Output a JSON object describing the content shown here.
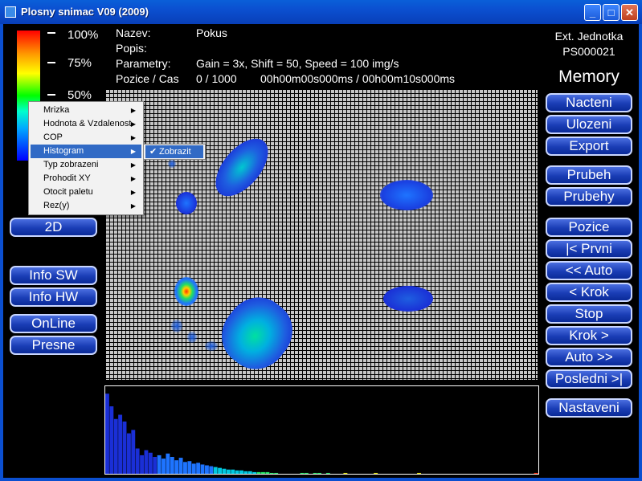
{
  "window": {
    "title": "Plosny snimac V09 (2009)",
    "minimize": "_",
    "maximize": "□",
    "close": "✕"
  },
  "palette_labels": [
    "100%",
    "75%",
    "50%"
  ],
  "info": {
    "nazev_label": "Nazev:",
    "nazev_value": "Pokus",
    "popis_label": "Popis:",
    "parametry_label": "Parametry:",
    "parametry_value": "Gain = 3x, Shift = 50, Speed = 100 img/s",
    "pozice_label": "Pozice / Cas",
    "pozice_value": "0 / 1000",
    "cas_value": "00h00m00s000ms / 00h00m10s000ms"
  },
  "device": {
    "line1": "Ext. Jednotka",
    "line2": "PS000021",
    "memory": "Memory"
  },
  "right_buttons": [
    "Nacteni",
    "Ulozeni",
    "Export",
    "Prubeh",
    "Prubehy",
    "Pozice",
    "|< Prvni",
    "<< Auto",
    "< Krok",
    "Stop",
    "Krok >",
    "Auto >>",
    "Posledni >|",
    "Nastaveni"
  ],
  "left_buttons": [
    "2D",
    "Info SW",
    "Info HW",
    "OnLine",
    "Presne"
  ],
  "context_menu": {
    "items": [
      "Mrizka",
      "Hodnota & Vzdalenost",
      "COP",
      "Histogram",
      "Typ zobrazeni",
      "Prohodit XY",
      "Otocit paletu",
      "Rez(y)"
    ],
    "selected": "Histogram",
    "submenu_item": "Zobrazit",
    "check": "✔",
    "arrow": "▶"
  },
  "colors": {
    "button_fill": "#1a3db5",
    "menu_highlight": "#316ac5",
    "grid_fill": "#c6c6c6"
  },
  "histogram_data": {
    "type": "bar",
    "values": [
      95,
      80,
      65,
      70,
      62,
      48,
      52,
      30,
      22,
      28,
      25,
      20,
      22,
      18,
      24,
      20,
      16,
      19,
      14,
      15,
      12,
      13,
      11,
      10,
      9,
      8,
      7,
      6,
      5,
      5,
      4,
      4,
      3,
      3,
      2,
      2,
      2,
      2,
      1,
      1,
      0,
      0,
      0,
      0,
      0,
      1,
      1,
      0,
      1,
      1,
      0,
      1,
      0,
      0,
      0,
      1,
      0,
      0,
      0,
      0,
      0,
      0,
      1,
      0,
      0,
      0,
      0,
      0,
      0,
      0,
      0,
      0,
      1,
      0,
      0,
      0,
      0,
      0,
      0,
      0,
      0,
      0,
      0,
      0,
      0,
      0,
      0,
      0,
      0,
      0,
      0,
      0,
      0,
      0,
      0,
      0,
      0,
      0,
      0,
      1
    ]
  }
}
